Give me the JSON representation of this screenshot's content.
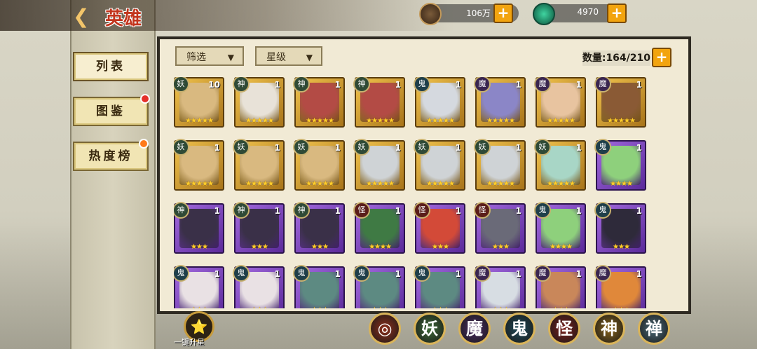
{
  "header": {
    "back_icon": "back-arrow-icon",
    "title": "英雄"
  },
  "resources": [
    {
      "icon": "coin-icon",
      "value": "106万"
    },
    {
      "icon": "jade-icon",
      "value": "4970"
    }
  ],
  "nav": [
    {
      "label": "列表",
      "active": true,
      "badge": false
    },
    {
      "label": "图鉴",
      "active": false,
      "badge": true
    },
    {
      "label": "热度榜",
      "active": false,
      "badge": true
    }
  ],
  "filters": {
    "filter_label": "筛选",
    "star_label": "星级"
  },
  "count": {
    "label": "数量:",
    "value": "164/210"
  },
  "heroes": [
    {
      "type": "妖",
      "level": "10",
      "frame": "gold",
      "stars": 5,
      "color": "#d9b980"
    },
    {
      "type": "神",
      "level": "1",
      "frame": "gold",
      "stars": 5,
      "color": "#e8e2d8"
    },
    {
      "type": "神",
      "level": "1",
      "frame": "gold",
      "stars": 5,
      "color": "#b34b45"
    },
    {
      "type": "神",
      "level": "1",
      "frame": "gold",
      "stars": 5,
      "color": "#b34b45"
    },
    {
      "type": "鬼",
      "level": "1",
      "frame": "gold",
      "stars": 5,
      "color": "#d5d9df"
    },
    {
      "type": "魔",
      "level": "1",
      "frame": "gold",
      "stars": 5,
      "color": "#8b86c7"
    },
    {
      "type": "魔",
      "level": "1",
      "frame": "gold",
      "stars": 5,
      "color": "#e8c4a0"
    },
    {
      "type": "魔",
      "level": "1",
      "frame": "gold",
      "stars": 5,
      "color": "#8a5a35"
    },
    {
      "type": "妖",
      "level": "1",
      "frame": "gold",
      "stars": 5,
      "color": "#d9b980"
    },
    {
      "type": "妖",
      "level": "1",
      "frame": "gold",
      "stars": 5,
      "color": "#d9b980"
    },
    {
      "type": "妖",
      "level": "1",
      "frame": "gold",
      "stars": 5,
      "color": "#d9b980"
    },
    {
      "type": "妖",
      "level": "1",
      "frame": "gold",
      "stars": 5,
      "color": "#cfd3d6"
    },
    {
      "type": "妖",
      "level": "1",
      "frame": "gold",
      "stars": 5,
      "color": "#cfd3d6"
    },
    {
      "type": "妖",
      "level": "1",
      "frame": "gold",
      "stars": 5,
      "color": "#cfd3d6"
    },
    {
      "type": "妖",
      "level": "1",
      "frame": "gold",
      "stars": 5,
      "color": "#a8d6c6"
    },
    {
      "type": "鬼",
      "level": "1",
      "frame": "purple",
      "stars": 4,
      "color": "#8ed07c"
    },
    {
      "type": "神",
      "level": "1",
      "frame": "purple",
      "stars": 3,
      "color": "#3a3048"
    },
    {
      "type": "神",
      "level": "1",
      "frame": "purple",
      "stars": 3,
      "color": "#3a3048"
    },
    {
      "type": "神",
      "level": "1",
      "frame": "purple",
      "stars": 3,
      "color": "#3a3048"
    },
    {
      "type": "怪",
      "level": "1",
      "frame": "purple",
      "stars": 4,
      "color": "#3f7a44"
    },
    {
      "type": "怪",
      "level": "1",
      "frame": "purple",
      "stars": 3,
      "color": "#d34a38"
    },
    {
      "type": "怪",
      "level": "1",
      "frame": "purple",
      "stars": 3,
      "color": "#6a6a78"
    },
    {
      "type": "鬼",
      "level": "1",
      "frame": "purple",
      "stars": 4,
      "color": "#8ed07c"
    },
    {
      "type": "鬼",
      "level": "1",
      "frame": "purple",
      "stars": 3,
      "color": "#2e2a3a"
    },
    {
      "type": "鬼",
      "level": "1",
      "frame": "purple",
      "stars": 3,
      "color": "#e9e1e4"
    },
    {
      "type": "鬼",
      "level": "1",
      "frame": "purple",
      "stars": 3,
      "color": "#e9e1e4"
    },
    {
      "type": "鬼",
      "level": "1",
      "frame": "purple",
      "stars": 3,
      "color": "#5d8a82"
    },
    {
      "type": "鬼",
      "level": "1",
      "frame": "purple",
      "stars": 3,
      "color": "#5d8a82"
    },
    {
      "type": "鬼",
      "level": "1",
      "frame": "purple",
      "stars": 3,
      "color": "#5d8a82"
    },
    {
      "type": "魔",
      "level": "1",
      "frame": "purple",
      "stars": 3,
      "color": "#d7dde3"
    },
    {
      "type": "魔",
      "level": "1",
      "frame": "purple",
      "stars": 3,
      "color": "#c9875a"
    },
    {
      "type": "魔",
      "level": "1",
      "frame": "purple",
      "stars": 3,
      "color": "#e0883a"
    }
  ],
  "bottom": {
    "upgrade_label": "一键升星",
    "upgrade_icon": "upgrade-star-icon",
    "factions": [
      {
        "label": "",
        "icon": "all-factions-icon",
        "color": "#8e2f1b"
      },
      {
        "label": "妖",
        "color": "#3f6b38"
      },
      {
        "label": "魔",
        "color": "#4a2b63"
      },
      {
        "label": "鬼",
        "color": "#1f4a58"
      },
      {
        "label": "怪",
        "color": "#7a1f1a"
      },
      {
        "label": "神",
        "color": "#8a6419"
      },
      {
        "label": "禅",
        "color": "#4a6a78"
      }
    ]
  }
}
